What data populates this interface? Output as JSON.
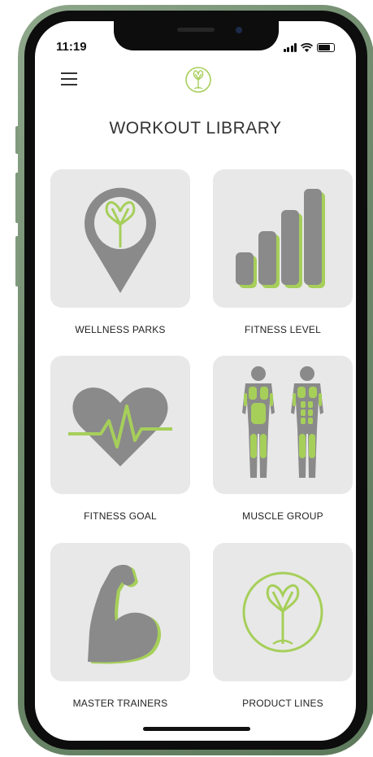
{
  "status": {
    "time": "11:19"
  },
  "header": {
    "title": "WORKOUT LIBRARY"
  },
  "tiles": [
    {
      "label": "WELLNESS PARKS",
      "icon": "map-pin-tree-icon"
    },
    {
      "label": "FITNESS LEVEL",
      "icon": "bar-levels-icon"
    },
    {
      "label": "FITNESS GOAL",
      "icon": "heart-pulse-icon"
    },
    {
      "label": "MUSCLE GROUP",
      "icon": "muscle-body-icon"
    },
    {
      "label": "MASTER TRAINERS",
      "icon": "flexed-arm-icon"
    },
    {
      "label": "PRODUCT LINES",
      "icon": "tree-logo-circle-icon"
    }
  ],
  "colors": {
    "accent": "#a6cf5a",
    "icon_gray": "#8a8a8a",
    "tile_bg": "#e8e8e8"
  }
}
